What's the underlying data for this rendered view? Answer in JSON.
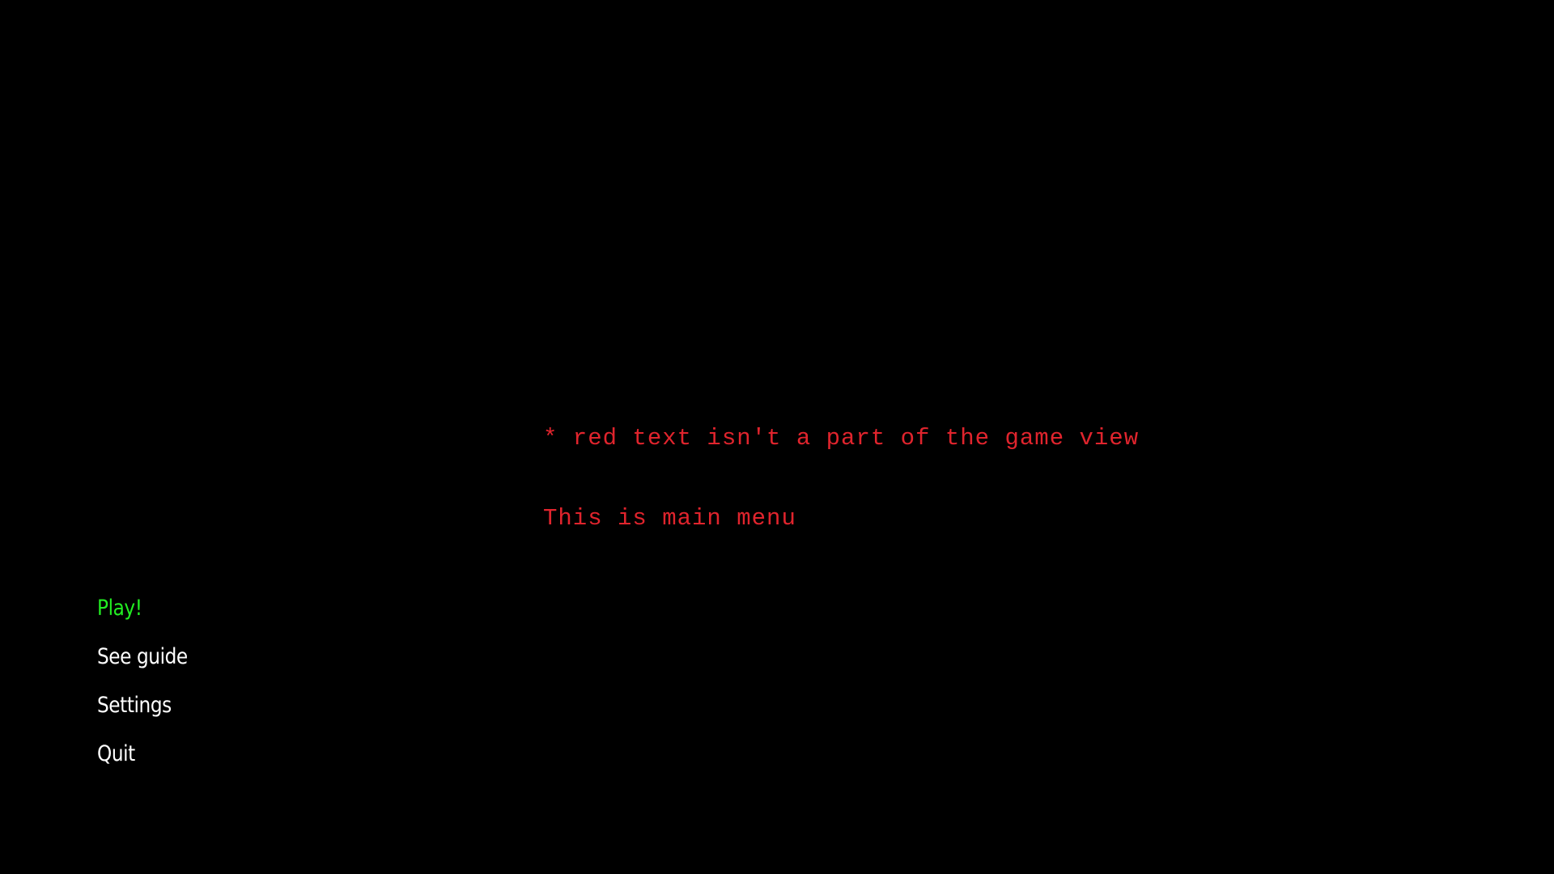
{
  "note": {
    "line1": "* red text isn't a part of the game view",
    "line2": "This is main menu"
  },
  "menu": {
    "items": [
      {
        "label": "Play!",
        "selected": true
      },
      {
        "label": "See guide",
        "selected": false
      },
      {
        "label": "Settings",
        "selected": false
      },
      {
        "label": "Quit",
        "selected": false
      }
    ]
  },
  "colors": {
    "background": "#000000",
    "selected_item": "#22ee22",
    "menu_item": "#ffffff",
    "annotation": "#e0242d"
  }
}
